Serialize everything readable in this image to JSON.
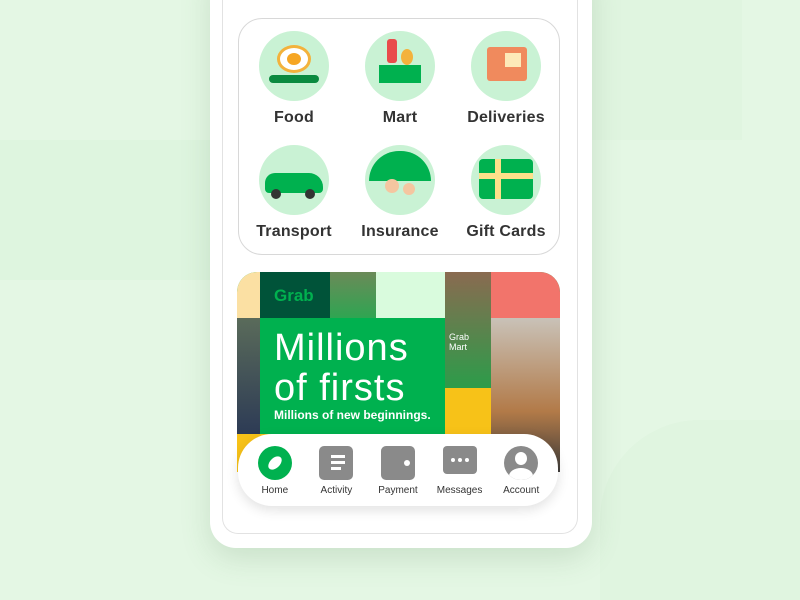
{
  "services": [
    {
      "label": "Food",
      "icon": "food-icon"
    },
    {
      "label": "Mart",
      "icon": "mart-icon"
    },
    {
      "label": "Deliveries",
      "icon": "deliveries-icon"
    },
    {
      "label": "Transport",
      "icon": "transport-icon"
    },
    {
      "label": "Insurance",
      "icon": "insurance-icon"
    },
    {
      "label": "Gift Cards",
      "icon": "gift-cards-icon"
    }
  ],
  "banner": {
    "logo": "Grab",
    "headline_1": "Millions",
    "headline_2": "of firsts",
    "subline": "Millions of new beginnings.",
    "apron_text": "Grab Mart"
  },
  "nav": [
    {
      "label": "Home",
      "icon": "compass-icon",
      "active": true
    },
    {
      "label": "Activity",
      "icon": "receipt-icon"
    },
    {
      "label": "Payment",
      "icon": "wallet-icon"
    },
    {
      "label": "Messages",
      "icon": "chat-icon"
    },
    {
      "label": "Account",
      "icon": "user-icon"
    }
  ],
  "colors": {
    "brand": "#00b14f",
    "brand_dark": "#005339",
    "background": "#e4f7e4",
    "icon_gray": "#8a8a8a"
  }
}
